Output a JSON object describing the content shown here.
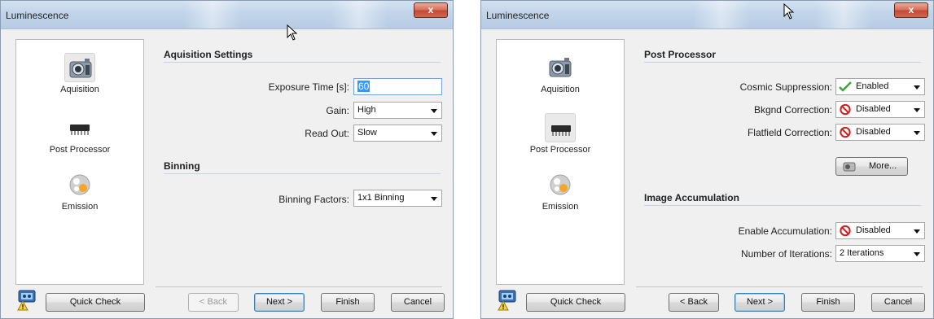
{
  "left": {
    "title": "Luminescence",
    "close": "x",
    "nav": [
      {
        "label": "Aquisition",
        "icon": "camera-icon"
      },
      {
        "label": "Post Processor",
        "icon": "chip-icon"
      },
      {
        "label": "Emission",
        "icon": "emission-icon"
      }
    ],
    "sections": {
      "acq": "Aquisition Settings",
      "binning": "Binning"
    },
    "fields": {
      "exposure_label": "Exposure Time [s]:",
      "exposure_value": "60",
      "gain_label": "Gain:",
      "gain_value": "High",
      "readout_label": "Read Out:",
      "readout_value": "Slow",
      "binning_label": "Binning Factors:",
      "binning_value": "1x1 Binning"
    },
    "buttons": {
      "quick_check": "Quick Check",
      "back": "< Back",
      "next": "Next >",
      "finish": "Finish",
      "cancel": "Cancel"
    }
  },
  "right": {
    "title": "Luminescence",
    "close": "x",
    "nav": [
      {
        "label": "Aquisition",
        "icon": "camera-icon"
      },
      {
        "label": "Post Processor",
        "icon": "chip-icon"
      },
      {
        "label": "Emission",
        "icon": "emission-icon"
      }
    ],
    "sections": {
      "post": "Post Processor",
      "accum": "Image Accumulation"
    },
    "fields": {
      "cosmic_label": "Cosmic Suppression:",
      "cosmic_value": "Enabled",
      "bkgnd_label": "Bkgnd Correction:",
      "bkgnd_value": "Disabled",
      "flat_label": "Flatfield Correction:",
      "flat_value": "Disabled",
      "more": "More...",
      "accum_label": "Enable Accumulation:",
      "accum_value": "Disabled",
      "iter_label": "Number of Iterations:",
      "iter_value": "2 Iterations"
    },
    "buttons": {
      "quick_check": "Quick Check",
      "back": "< Back",
      "next": "Next >",
      "finish": "Finish",
      "cancel": "Cancel"
    }
  },
  "colors": {
    "titlebar": "#c2d5ea",
    "close": "#c24a33",
    "selection": "#3399ff",
    "enabled_check": "#3aa63a",
    "disabled_sign": "#d02020"
  }
}
